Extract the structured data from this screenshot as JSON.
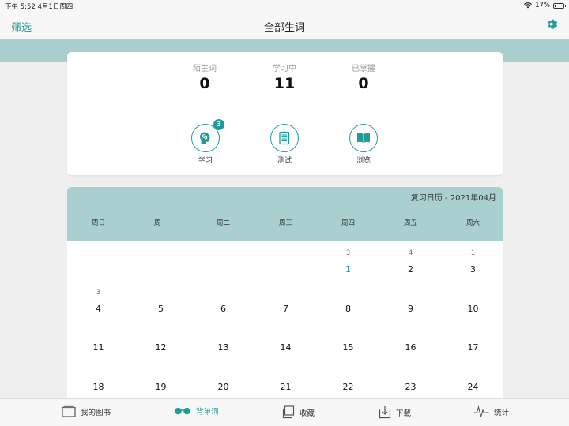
{
  "status_bar": {
    "time": "下午 5:52   4月1日周四",
    "battery": "17%",
    "battery_level": 0.17
  },
  "nav": {
    "filter_label": "筛选",
    "title": "全部生词"
  },
  "stats": [
    {
      "label": "陌生词",
      "value": "0"
    },
    {
      "label": "学习中",
      "value": "11"
    },
    {
      "label": "已掌握",
      "value": "0"
    }
  ],
  "actions": [
    {
      "label": "学习",
      "icon": "brain-head-icon",
      "badge": "3"
    },
    {
      "label": "测试",
      "icon": "test-sheet-icon"
    },
    {
      "label": "浏览",
      "icon": "open-book-icon"
    }
  ],
  "calendar": {
    "title": "复习日历 - 2021年04月",
    "weekdays": [
      "周日",
      "周一",
      "周二",
      "周三",
      "周四",
      "周五",
      "周六"
    ],
    "weeks": [
      [
        {
          "day": "",
          "count": ""
        },
        {
          "day": "",
          "count": ""
        },
        {
          "day": "",
          "count": ""
        },
        {
          "day": "",
          "count": ""
        },
        {
          "day": "1",
          "count": "3",
          "today": true
        },
        {
          "day": "2",
          "count": "4"
        },
        {
          "day": "3",
          "count": "1"
        }
      ],
      [
        {
          "day": "4",
          "count": "3"
        },
        {
          "day": "5",
          "count": ""
        },
        {
          "day": "6",
          "count": ""
        },
        {
          "day": "7",
          "count": ""
        },
        {
          "day": "8",
          "count": ""
        },
        {
          "day": "9",
          "count": ""
        },
        {
          "day": "10",
          "count": ""
        }
      ],
      [
        {
          "day": "11",
          "count": ""
        },
        {
          "day": "12",
          "count": ""
        },
        {
          "day": "13",
          "count": ""
        },
        {
          "day": "14",
          "count": ""
        },
        {
          "day": "15",
          "count": ""
        },
        {
          "day": "16",
          "count": ""
        },
        {
          "day": "17",
          "count": ""
        }
      ],
      [
        {
          "day": "18",
          "count": ""
        },
        {
          "day": "19",
          "count": ""
        },
        {
          "day": "20",
          "count": ""
        },
        {
          "day": "21",
          "count": ""
        },
        {
          "day": "22",
          "count": ""
        },
        {
          "day": "23",
          "count": ""
        },
        {
          "day": "24",
          "count": ""
        }
      ]
    ]
  },
  "tabs": [
    {
      "label": "我的图书",
      "icon": "bookshelf-icon"
    },
    {
      "label": "背单词",
      "icon": "glasses-icon",
      "active": true
    },
    {
      "label": "收藏",
      "icon": "collection-icon"
    },
    {
      "label": "下载",
      "icon": "download-icon"
    },
    {
      "label": "统计",
      "icon": "stats-pulse-icon"
    }
  ],
  "colors": {
    "accent": "#1f9c9a",
    "band": "#a9cfcf"
  }
}
